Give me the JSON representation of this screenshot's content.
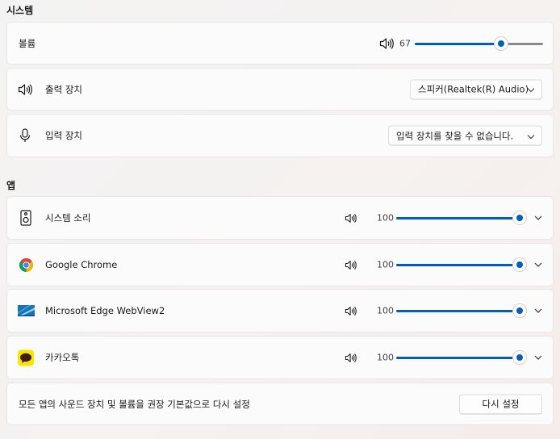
{
  "system": {
    "title": "시스템",
    "volume_label": "볼륨",
    "volume_value": "67",
    "volume_level": 0.67,
    "output": {
      "label": "출력 장치",
      "value": "스피커(Realtek(R) Audio)"
    },
    "input": {
      "label": "입력 장치",
      "value": "입력 장치를 찾을 수 없습니다."
    }
  },
  "apps": {
    "title": "앱",
    "items": [
      {
        "name": "시스템 소리",
        "volume": "100",
        "icon": "system-sounds-icon",
        "level": 1.0
      },
      {
        "name": "Google Chrome",
        "volume": "100",
        "icon": "chrome-icon",
        "level": 1.0
      },
      {
        "name": "Microsoft Edge WebView2",
        "volume": "100",
        "icon": "edge-webview-icon",
        "level": 1.0
      },
      {
        "name": "카카오톡",
        "volume": "100",
        "icon": "kakaotalk-icon",
        "level": 1.0
      }
    ]
  },
  "reset": {
    "label": "모든 앱의 사운드 장치 및 볼륨을 권장 기본값으로 다시 설정",
    "button": "다시 설정"
  },
  "colors": {
    "accent": "#005fb8",
    "kakao_yellow": "#fee500",
    "track": "#8a8a8a"
  }
}
